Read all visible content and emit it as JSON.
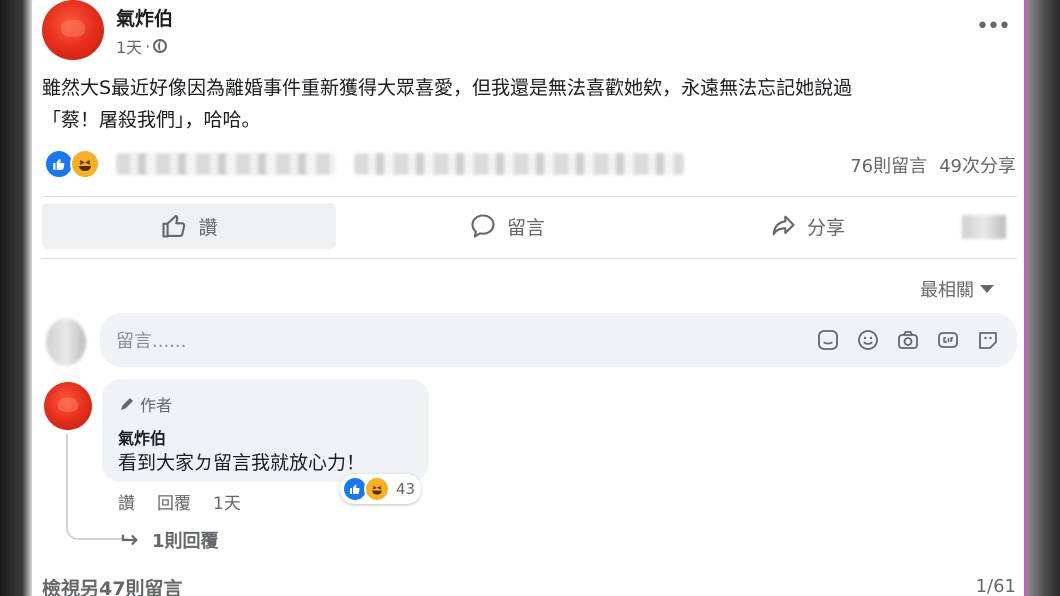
{
  "post": {
    "author": "氣炸伯",
    "time": "1天",
    "dot": "·",
    "more": "•••",
    "text_line1": "雖然大S最近好像因為離婚事件重新獲得大眾喜愛，但我還是無法喜歡她欸，永遠無法忘記她說過",
    "text_line2": "「蔡！屠殺我們」，哈哈。",
    "reactions": [
      "like-reaction",
      "haha-reaction"
    ],
    "comment_count": "76則留言",
    "share_count": "49次分享"
  },
  "actions": {
    "like": "讚",
    "comment": "留言",
    "share": "分享"
  },
  "sort": {
    "label": "最相關"
  },
  "composer": {
    "placeholder": "留言......",
    "icons": [
      "sticker-icon",
      "emoji-icon",
      "camera-icon",
      "gif-icon",
      "avatar-sticker-icon"
    ]
  },
  "comment": {
    "badge": "作者",
    "author": "氣炸伯",
    "text": "看到大家ㄉ留言我就放心力！",
    "like": "讚",
    "reply": "回覆",
    "time": "1天",
    "reaction_count": "43",
    "replies": "1則回覆"
  },
  "footer": {
    "view_more": "檢視另47則留言",
    "pager": "1/61"
  },
  "colors": {
    "like_blue": "#1877f2",
    "haha_yellow": "#f7b125",
    "text_gray": "#65676b",
    "input_bg": "#f0f2f5"
  }
}
